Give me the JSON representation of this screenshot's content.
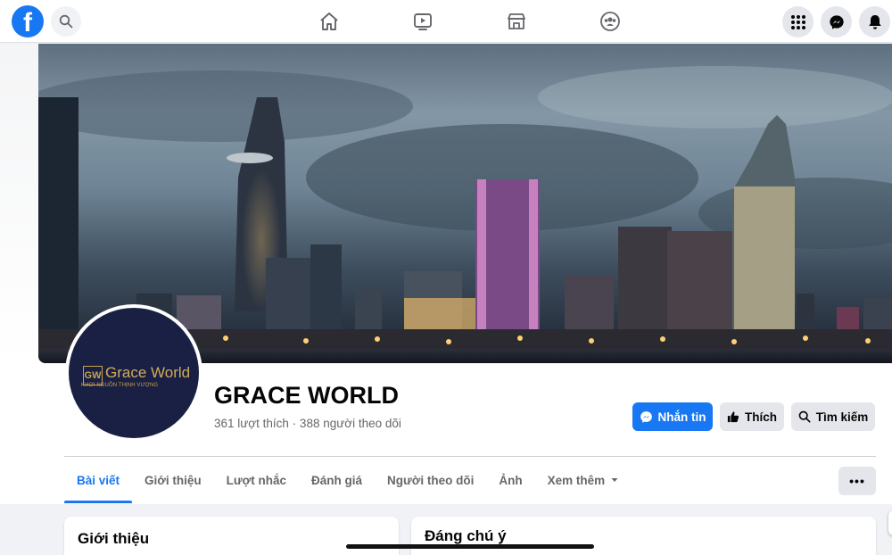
{
  "topbar": {
    "logo_letter": "f",
    "icons": [
      "facebook-logo",
      "search-icon",
      "home-icon",
      "watch-icon",
      "marketplace-icon",
      "groups-icon",
      "menu-grid-icon",
      "messenger-icon",
      "notifications-icon"
    ]
  },
  "profile": {
    "name": "GRACE WORLD",
    "stats": "361 lượt thích · 388 người theo dõi",
    "logo_mark": "GW",
    "logo_text": "Grace World",
    "logo_tagline": "KHƠI NGUỒN THỊNH VƯỢNG"
  },
  "actions": {
    "message_label": "Nhắn tin",
    "like_label": "Thích",
    "search_label": "Tìm kiếm",
    "more_label": "•••"
  },
  "tabs": [
    {
      "label": "Bài viết",
      "active": true
    },
    {
      "label": "Giới thiệu"
    },
    {
      "label": "Lượt nhắc"
    },
    {
      "label": "Đánh giá"
    },
    {
      "label": "Người theo dõi"
    },
    {
      "label": "Ảnh"
    },
    {
      "label": "Xem thêm"
    }
  ],
  "cards": {
    "intro_title": "Giới thiệu",
    "featured_title": "Đáng chú ý"
  },
  "colors": {
    "brand": "#1877f2",
    "logo_gold": "#c9a34b",
    "logo_navy": "#1a1f44"
  }
}
